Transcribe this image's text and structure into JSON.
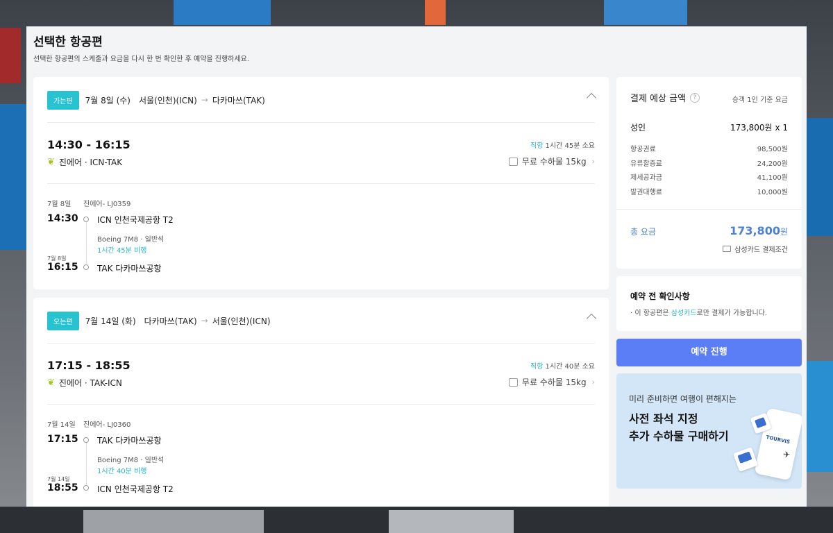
{
  "page": {
    "title": "선택한 항공편",
    "subtitle": "선택한 항공편의 스케줄과 요금을 다시 한 번 확인한 후 예약을 진행하세요."
  },
  "outbound": {
    "badge": "가는편",
    "date": "7월 8일 (수)",
    "from": "서울(인천)(ICN)",
    "to": "다카마쓰(TAK)",
    "time_range": "14:30 - 16:15",
    "direct": "직항",
    "duration_text": "1시간 45분 소요",
    "airline_route": "진에어 · ICN-TAK",
    "baggage": "무료 수하물 15kg",
    "segment": {
      "date": "7월 8일",
      "flight": "진에어- LJ0359",
      "dep_time": "14:30",
      "dep_place": "ICN 인천국제공항 T2",
      "aircraft": "Boeing 7M8 · 일반석",
      "flight_time": "1시간 45분 비행",
      "arr_date": "7월 8일",
      "arr_time": "16:15",
      "arr_place": "TAK 다카마쓰공항"
    }
  },
  "return": {
    "badge": "오는편",
    "date": "7월 14일 (화)",
    "from": "다카마쓰(TAK)",
    "to": "서울(인천)(ICN)",
    "time_range": "17:15 - 18:55",
    "direct": "직항",
    "duration_text": "1시간 40분 소요",
    "airline_route": "진에어 · TAK-ICN",
    "baggage": "무료 수하물 15kg",
    "segment": {
      "date": "7월 14일",
      "flight": "진에어- LJ0360",
      "dep_time": "17:15",
      "dep_place": "TAK 다카마쓰공항",
      "aircraft": "Boeing 7M8 · 일반석",
      "flight_time": "1시간 40분 비행",
      "arr_date": "7월 14일",
      "arr_time": "18:55",
      "arr_place": "ICN 인천국제공항 T2"
    }
  },
  "price": {
    "title": "결제 예상 금액",
    "help": "?",
    "basis": "승객 1인 기준 요금",
    "adult_label": "성인",
    "adult_price": "173,800원",
    "adult_count": "x 1",
    "fees": [
      {
        "label": "항공권료",
        "value": "98,500원"
      },
      {
        "label": "유류할증료",
        "value": "24,200원"
      },
      {
        "label": "제세공과금",
        "value": "41,100원"
      },
      {
        "label": "발권대행료",
        "value": "10,000원"
      }
    ],
    "total_label": "총 요금",
    "total_value": "173,800",
    "total_unit": "원",
    "card_condition": "삼성카드 결제조건"
  },
  "notice": {
    "title": "예약 전 확인사항",
    "prefix": "· 이 항공편은 ",
    "highlight": "삼성카드",
    "suffix": "로만 결제가 가능합니다."
  },
  "reserve_button": "예약 진행",
  "promo": {
    "sub": "미리 준비하면 여행이 편해지는",
    "line1": "사전 좌석 지정",
    "line2": "추가 수하물 구매하기",
    "logo": "TOURVIS"
  },
  "colors": {
    "accent": "#27c3d0",
    "button": "#5b7df5",
    "total": "#4a82d6",
    "promo_bg": "#d2e6f7"
  }
}
